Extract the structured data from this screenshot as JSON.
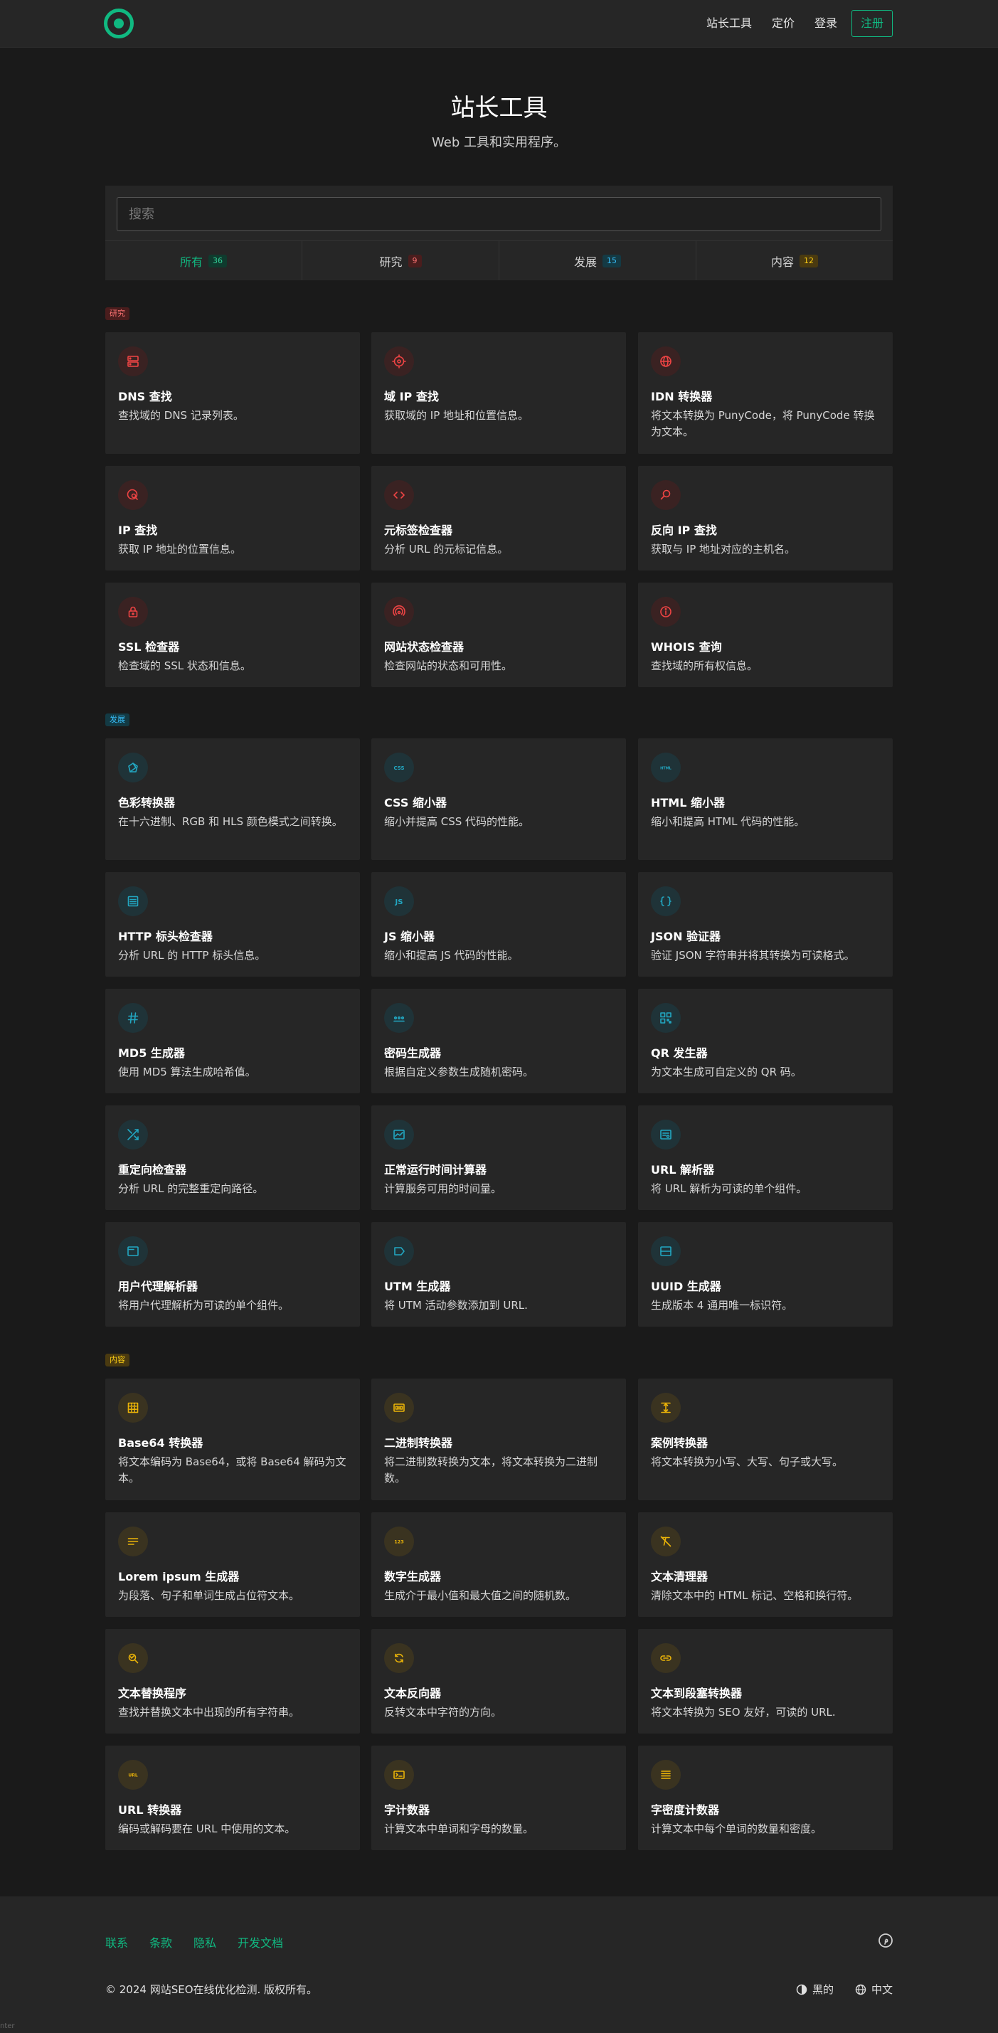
{
  "nav": {
    "links": [
      "站长工具",
      "定价",
      "登录"
    ],
    "signup": "注册"
  },
  "hero": {
    "title": "站长工具",
    "subtitle": "Web 工具和实用程序。"
  },
  "search": {
    "placeholder": "搜索"
  },
  "filters": [
    {
      "label": "所有",
      "count": "36"
    },
    {
      "label": "研究",
      "count": "9"
    },
    {
      "label": "发展",
      "count": "15"
    },
    {
      "label": "内容",
      "count": "12"
    }
  ],
  "colors": {
    "accent": "#10b981",
    "research": "#ef4444",
    "develop": "#22a7c2",
    "content": "#eab308"
  },
  "sections": [
    {
      "badge": "研究",
      "tools": [
        {
          "title": "DNS 查找",
          "desc": "查找域的 DNS 记录列表。",
          "icon": "server-icon"
        },
        {
          "title": "域 IP 查找",
          "desc": "获取域的 IP 地址和位置信息。",
          "icon": "location-icon"
        },
        {
          "title": "IDN 转换器",
          "desc": "将文本转换为 PunyCode，将 PunyCode 转换为文本。",
          "icon": "globe-icon"
        },
        {
          "title": "IP 查找",
          "desc": "获取 IP 地址的位置信息。",
          "icon": "map-search-icon"
        },
        {
          "title": "元标签检查器",
          "desc": "分析 URL 的元标记信息。",
          "icon": "code-icon"
        },
        {
          "title": "反向 IP 查找",
          "desc": "获取与 IP 地址对应的主机名。",
          "icon": "search-icon"
        },
        {
          "title": "SSL 检查器",
          "desc": "检查域的 SSL 状态和信息。",
          "icon": "lock-icon"
        },
        {
          "title": "网站状态检查器",
          "desc": "检查网站的状态和可用性。",
          "icon": "signal-icon"
        },
        {
          "title": "WHOIS 查询",
          "desc": "查找域的所有权信息。",
          "icon": "info-icon"
        }
      ]
    },
    {
      "badge": "发展",
      "tools": [
        {
          "title": "色彩转换器",
          "desc": "在十六进制、RGB 和 HLS 颜色模式之间转换。",
          "icon": "palette-icon"
        },
        {
          "title": "CSS 缩小器",
          "desc": "缩小并提高 CSS 代码的性能。",
          "icon": "css-icon"
        },
        {
          "title": "HTML 缩小器",
          "desc": "缩小和提高 HTML 代码的性能。",
          "icon": "html-icon"
        },
        {
          "title": "HTTP 标头检查器",
          "desc": "分析 URL 的 HTTP 标头信息。",
          "icon": "list-icon"
        },
        {
          "title": "JS 缩小器",
          "desc": "缩小和提高 JS 代码的性能。",
          "icon": "js-icon"
        },
        {
          "title": "JSON 验证器",
          "desc": "验证 JSON 字符串并将其转换为可读格式。",
          "icon": "braces-icon"
        },
        {
          "title": "MD5 生成器",
          "desc": "使用 MD5 算法生成哈希值。",
          "icon": "hash-icon"
        },
        {
          "title": "密码生成器",
          "desc": "根据自定义参数生成随机密码。",
          "icon": "password-icon"
        },
        {
          "title": "QR 发生器",
          "desc": "为文本生成可自定义的 QR 码。",
          "icon": "qr-icon"
        },
        {
          "title": "重定向检查器",
          "desc": "分析 URL 的完整重定向路径。",
          "icon": "shuffle-icon"
        },
        {
          "title": "正常运行时间计算器",
          "desc": "计算服务可用的时间量。",
          "icon": "uptime-icon"
        },
        {
          "title": "URL 解析器",
          "desc": "将 URL 解析为可读的单个组件。",
          "icon": "url-parse-icon"
        },
        {
          "title": "用户代理解析器",
          "desc": "将用户代理解析为可读的单个组件。",
          "icon": "window-icon"
        },
        {
          "title": "UTM 生成器",
          "desc": "将 UTM 活动参数添加到 URL.",
          "icon": "tag-icon"
        },
        {
          "title": "UUID 生成器",
          "desc": "生成版本 4 通用唯一标识符。",
          "icon": "id-card-icon"
        }
      ]
    },
    {
      "badge": "内容",
      "tools": [
        {
          "title": "Base64 转换器",
          "desc": "将文本编码为 Base64，或将 Base64 解码为文本。",
          "icon": "grid-icon"
        },
        {
          "title": "二进制转换器",
          "desc": "将二进制数转换为文本，将文本转换为二进制数。",
          "icon": "binary-icon"
        },
        {
          "title": "案例转换器",
          "desc": "将文本转换为小写、大写、句子或大写。",
          "icon": "text-height-icon"
        },
        {
          "title": "Lorem ipsum 生成器",
          "desc": "为段落、句子和单词生成占位符文本。",
          "icon": "paragraph-icon"
        },
        {
          "title": "数字生成器",
          "desc": "生成介于最小值和最大值之间的随机数。",
          "icon": "numbers-icon"
        },
        {
          "title": "文本清理器",
          "desc": "清除文本中的 HTML 标记、空格和换行符。",
          "icon": "clear-format-icon"
        },
        {
          "title": "文本替换程序",
          "desc": "查找并替换文本中出现的所有字符串。",
          "icon": "replace-icon"
        },
        {
          "title": "文本反向器",
          "desc": "反转文本中字符的方向。",
          "icon": "refresh-icon"
        },
        {
          "title": "文本到段塞转换器",
          "desc": "将文本转换为 SEO 友好，可读的 URL.",
          "icon": "link-icon"
        },
        {
          "title": "URL 转换器",
          "desc": "编码或解码要在 URL 中使用的文本。",
          "icon": "url-icon"
        },
        {
          "title": "字计数器",
          "desc": "计算文本中单词和字母的数量。",
          "icon": "counter-icon"
        },
        {
          "title": "字密度计数器",
          "desc": "计算文本中每个单词的数量和密度。",
          "icon": "density-icon"
        }
      ]
    }
  ],
  "footer": {
    "links": [
      "联系",
      "条款",
      "隐私",
      "开发文档"
    ],
    "copyright": "© 2024 网站SEO在线优化检测. 版权所有。",
    "theme": "黑的",
    "language": "中文"
  },
  "corner_text": "nter"
}
